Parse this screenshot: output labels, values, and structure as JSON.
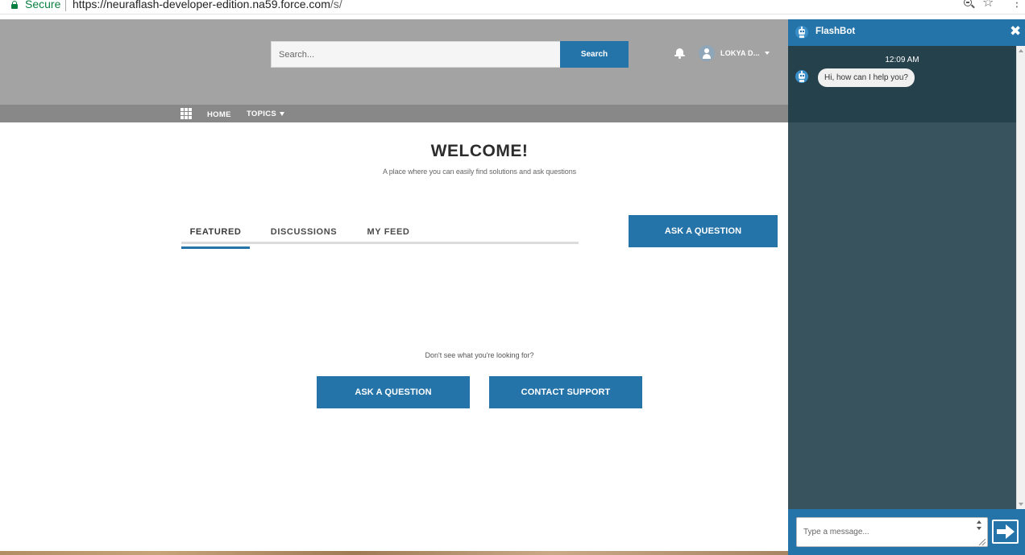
{
  "browser": {
    "secure_label": "Secure",
    "url_host": "https://neuraflash-developer-edition.na59.force.com",
    "url_path": "/s/"
  },
  "header": {
    "search_placeholder": "Search...",
    "search_button": "Search",
    "user_name": "LOKYA D..."
  },
  "nav": {
    "home": "HOME",
    "topics": "TOPICS"
  },
  "main": {
    "title": "WELCOME!",
    "subtitle": "A place where you can easily find solutions and ask questions",
    "tabs": [
      {
        "label": "FEATURED",
        "active": true
      },
      {
        "label": "DISCUSSIONS",
        "active": false
      },
      {
        "label": "MY FEED",
        "active": false
      }
    ],
    "ask_question_top": "ASK A QUESTION",
    "dont_see": "Don't see what you're looking for?",
    "ask_question_bottom": "ASK A QUESTION",
    "contact_support": "CONTACT SUPPORT"
  },
  "chat": {
    "title": "FlashBot",
    "time": "12:09 AM",
    "bot_message": "Hi, how can I help you?",
    "input_placeholder": "Type a message..."
  },
  "colors": {
    "accent": "#2574a9",
    "header_bg": "#a3a3a3",
    "nav_bg": "#888888",
    "chat_bg": "#38525e",
    "chat_messages_bg": "#25414c"
  }
}
